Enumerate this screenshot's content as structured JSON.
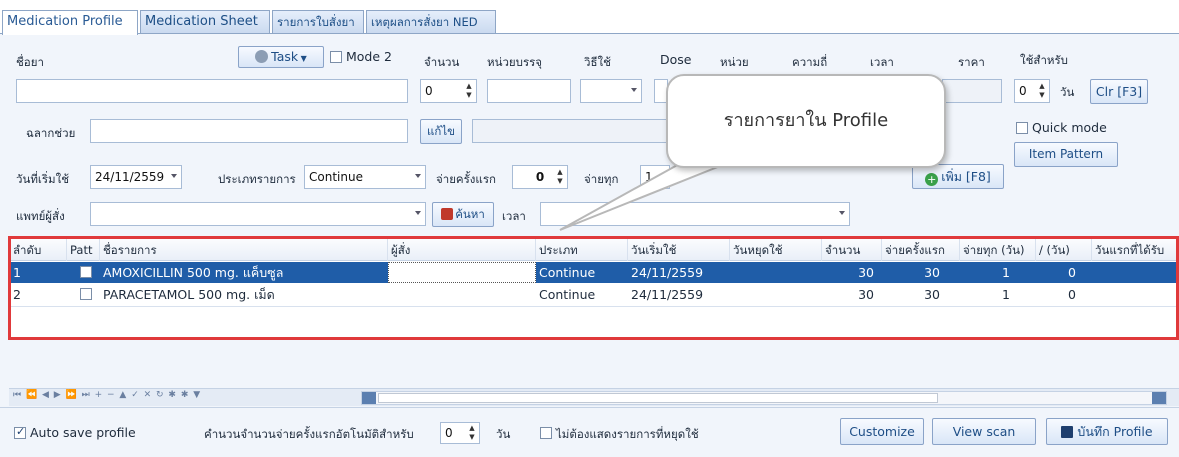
{
  "tabs": [
    "Medication Profile",
    "Medication Sheet",
    "รายการใบสั่งยา",
    "เหตุผลการสั่งยา NED"
  ],
  "form": {
    "drug_name_label": "ชื่อยา",
    "task_label": "Task",
    "mode2_label": "Mode 2",
    "qty_label": "จำนวน",
    "unit_label": "หน่วยบรรจุ",
    "method_label": "วิธีใช้",
    "dose_label": "Dose",
    "unit2_label": "หน่วย",
    "freq_label": "ความถี่",
    "time_label": "เวลา",
    "price_label": "ราคา",
    "use_for_label": "ใช้สำหรับ",
    "qty_value": "0",
    "use_for_value": "0",
    "day_unit": "วัน",
    "clr_label": "Clr [F3]",
    "helper_label_label": "ฉลากช่วย",
    "edit_label": "แก้ไข",
    "quick_mode_label": "Quick mode",
    "item_pattern_label": "Item Pattern",
    "start_date_label": "วันที่เริ่มใช้",
    "start_date_value": "24/11/2559",
    "list_type_label": "ประเภทรายการ",
    "list_type_value": "Continue",
    "first_dispense_label": "จ่ายครั้งแรก",
    "first_dispense_value": "0",
    "dispense_every_label": "จ่ายทุก",
    "dispense_every_value": "1",
    "add_label": "เพิ่ม [F8]",
    "doctor_label": "แพทย์ผู้สั่ง",
    "search_label": "ค้นหา",
    "time2_label": "เวลา"
  },
  "callout": "รายการยาใน Profile",
  "grid": {
    "headers": [
      "ลำดับ",
      "Patt",
      "ชื่อรายการ",
      "ผู้สั่ง",
      "ประเภท",
      "วันเริ่มใช้",
      "วันหยุดใช้",
      "จำนวน",
      "จ่ายครั้งแรก",
      "จ่ายทุก (วัน)",
      "/ (วัน)",
      "วันแรกที่ได้รับ"
    ],
    "rows": [
      {
        "no": "1",
        "name": "AMOXICILLIN 500 mg. แค็บซูล",
        "type": "Continue",
        "start": "24/11/2559",
        "qty": "30",
        "first": "30",
        "every": "1",
        "per": "0"
      },
      {
        "no": "2",
        "name": "PARACETAMOL 500 mg. เม็ด",
        "type": "Continue",
        "start": "24/11/2559",
        "qty": "30",
        "first": "30",
        "every": "1",
        "per": "0"
      }
    ]
  },
  "navigator": "⏮ ⏪ ◀ ▶ ⏩ ⏭ + − ▲ ✓ ✕ ↻ ✱ ✱ ▼",
  "bottom": {
    "auto_save_label": "Auto save profile",
    "auto_calc_label": "คำนวนจำนวนจ่ายครั้งแรกอัตโนมัติสำหรับ",
    "auto_calc_value": "0",
    "day_unit": "วัน",
    "hide_stopped_label": "ไม่ต้องแสดงรายการที่หยุดใช้",
    "customize_label": "Customize",
    "view_scan_label": "View scan",
    "save_profile_label": "บันทึก Profile"
  },
  "colors": {
    "selection": "#1f5da8",
    "highlight": "#e0393b",
    "accent": "#2a5b95"
  }
}
